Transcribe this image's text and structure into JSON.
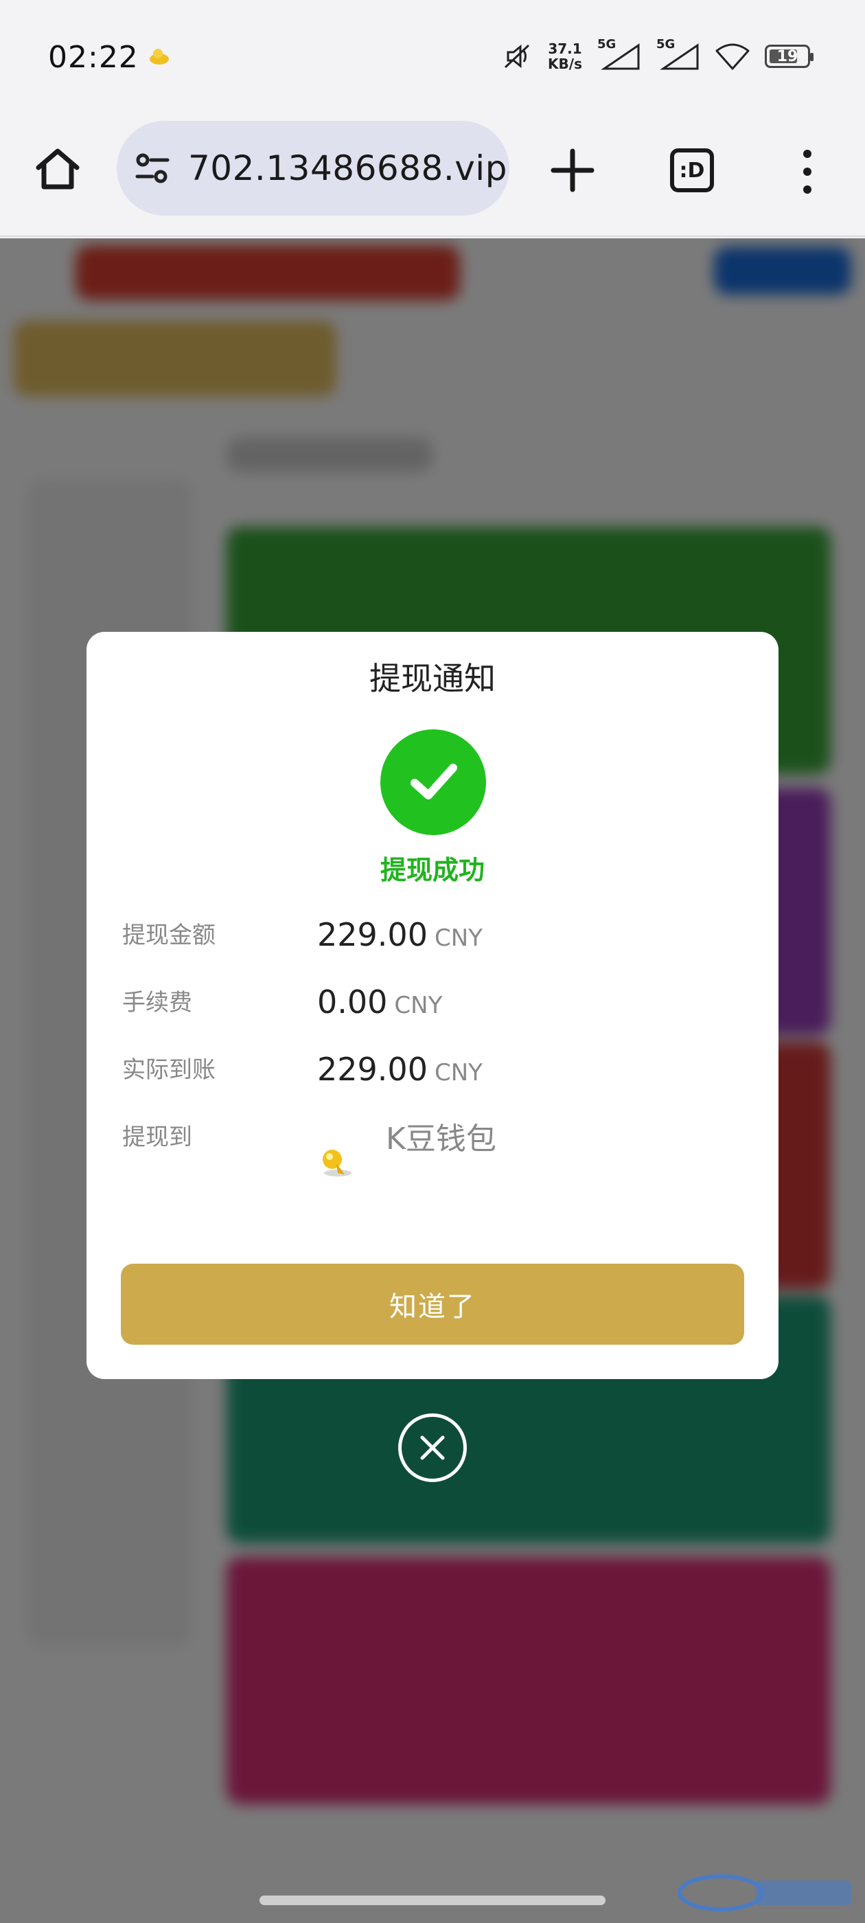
{
  "status_bar": {
    "time": "02:22",
    "net_speed_value": "37.1",
    "net_speed_unit": "KB/s",
    "signal1_label": "5G",
    "signal2_label": "5G",
    "battery": "19"
  },
  "browser": {
    "url": "702.13486688.vip",
    "tabs_label": ":D"
  },
  "dialog": {
    "title": "提现通知",
    "status": "提现成功",
    "rows": [
      {
        "label": "提现金额",
        "amount": "229.00",
        "currency": "CNY"
      },
      {
        "label": "手续费",
        "amount": "0.00",
        "currency": "CNY"
      },
      {
        "label": "实际到账",
        "amount": "229.00",
        "currency": "CNY"
      }
    ],
    "destination_label": "提现到",
    "wallet_name": "K豆钱包",
    "confirm_button": "知道了"
  },
  "colors": {
    "success_green": "#21c21f",
    "confirm_gold": "#cdab4c"
  }
}
